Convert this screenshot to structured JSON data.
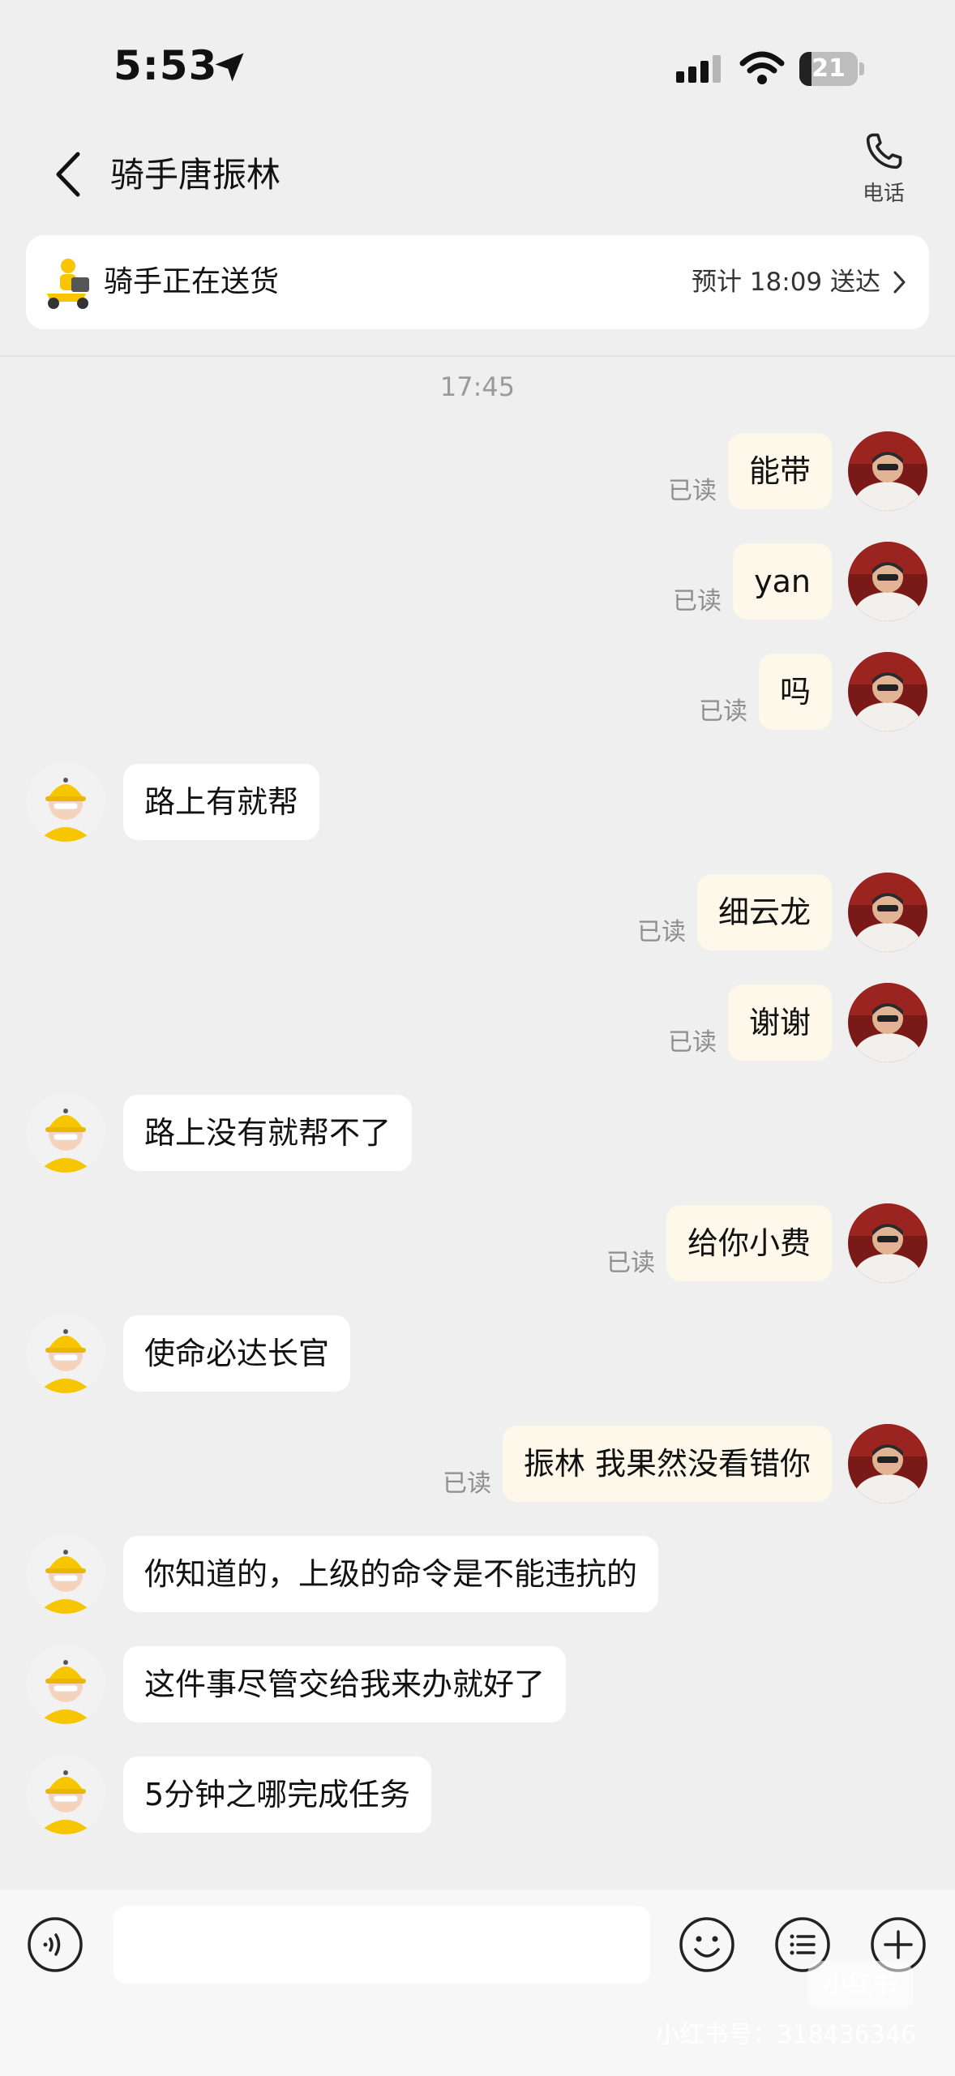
{
  "status_bar": {
    "time": "5:53",
    "battery": "21",
    "battery_level": 0.21
  },
  "nav": {
    "title": "骑手唐振林",
    "call_label": "电话"
  },
  "delivery": {
    "status": "骑手正在送货",
    "eta": "预计 18:09 送达"
  },
  "timestamp": "17:45",
  "read_label": "已读",
  "messages": [
    {
      "from": "me",
      "text": "能带",
      "read": true
    },
    {
      "from": "me",
      "text": "yan",
      "read": true
    },
    {
      "from": "me",
      "text": "吗",
      "read": true
    },
    {
      "from": "rider",
      "text": "路上有就帮"
    },
    {
      "from": "me",
      "text": "细云龙",
      "read": true
    },
    {
      "from": "me",
      "text": "谢谢",
      "read": true
    },
    {
      "from": "rider",
      "text": "路上没有就帮不了"
    },
    {
      "from": "me",
      "text": "给你小费",
      "read": true
    },
    {
      "from": "rider",
      "text": "使命必达长官"
    },
    {
      "from": "me",
      "text": "振林 我果然没看错你",
      "read": true
    },
    {
      "from": "rider",
      "text": "你知道的，上级的命令是不能违抗的"
    },
    {
      "from": "rider",
      "text": "这件事尽管交给我来办就好了"
    },
    {
      "from": "rider",
      "text": "5分钟之哪完成任务"
    }
  ],
  "input": {
    "value": ""
  },
  "watermark": {
    "logo": "小红书",
    "text": "小红书号：318436346"
  },
  "colors": {
    "my_bubble": "#fdf8e9",
    "rider_bubble": "#ffffff",
    "background": "#efefef",
    "rider_yellow": "#f7c600"
  },
  "icons": [
    "location-arrow-icon",
    "signal-icon",
    "wifi-icon",
    "back-chevron-icon",
    "phone-icon",
    "delivery-rider-icon",
    "chevron-right-icon",
    "voice-icon",
    "emoji-icon",
    "menu-list-icon",
    "plus-icon"
  ]
}
